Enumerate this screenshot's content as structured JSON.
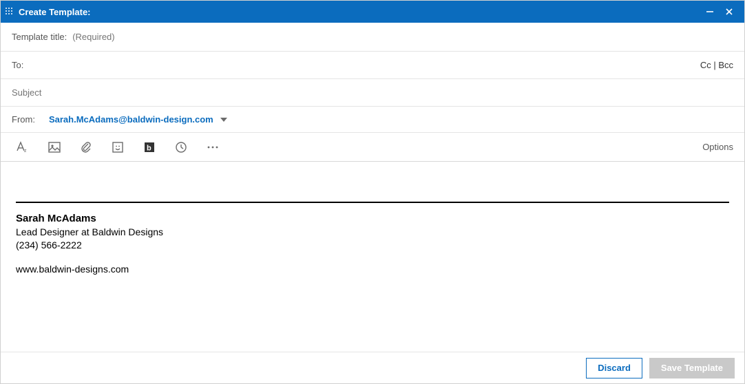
{
  "titlebar": {
    "title": "Create Template:"
  },
  "fields": {
    "template_title_label": "Template title:",
    "template_title_placeholder": "(Required)",
    "to_label": "To:",
    "cc_bcc": "Cc | Bcc",
    "subject_placeholder": "Subject",
    "from_label": "From:",
    "from_email": "Sarah.McAdams@baldwin-design.com"
  },
  "toolbar": {
    "options_label": "Options"
  },
  "signature": {
    "name": "Sarah McAdams",
    "role": "Lead Designer at Baldwin Designs",
    "phone": "(234) 566-2222",
    "website": "www.baldwin-designs.com"
  },
  "footer": {
    "discard": "Discard",
    "save": "Save Template"
  }
}
